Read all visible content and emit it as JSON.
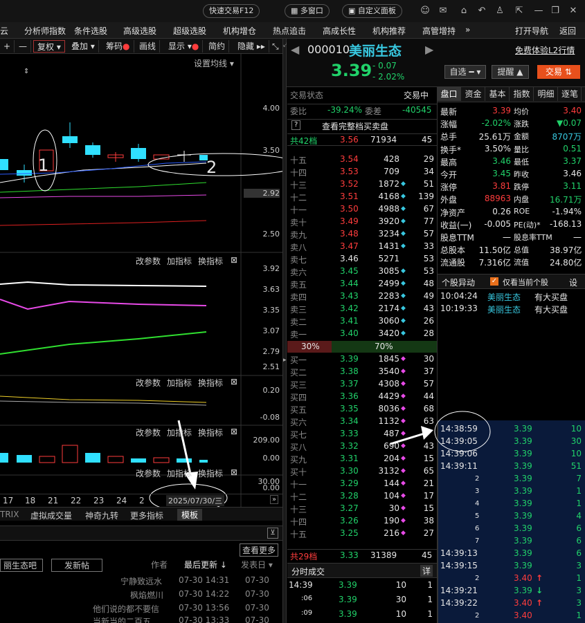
{
  "topbar": {
    "quick_trade": "快速交易F12",
    "multi_window": "多窗口",
    "custom_panel": "自定义面板"
  },
  "menu": [
    "云",
    "分析师指数",
    "条件选股",
    "高级选股",
    "超级选股",
    "机构增仓",
    "热点追击",
    "高成长性",
    "机构推荐",
    "高管增持"
  ],
  "menu_more": "»",
  "menu_right": [
    "打开导航",
    "返回"
  ],
  "chart_toolbar": {
    "items": [
      "复权",
      "叠加",
      "筹码",
      "画线",
      "显示",
      "简约",
      "隐藏"
    ],
    "set_ma": "设置均线"
  },
  "kline_axis": [
    "4.00",
    "3.50",
    "2.92",
    "2.50"
  ],
  "annotations": {
    "one": "1",
    "two": "2"
  },
  "sub_tools": {
    "params": "改参数",
    "add": "加指标",
    "switch": "换指标"
  },
  "sub1_axis": [
    "3.92",
    "3.63",
    "3.35",
    "3.07",
    "2.79",
    "2.51"
  ],
  "sub2_axis": [
    "0.20",
    "-0.08"
  ],
  "sub3_axis": [
    "209.00",
    "0.00"
  ],
  "sub4_axis": [
    "30.00",
    "0.00"
  ],
  "date_axis": [
    "17",
    "18",
    "21",
    "22",
    "23",
    "24",
    "2"
  ],
  "date_cursor": "2025/07/30/三",
  "bottom_tabs": [
    "TRIX",
    "虚拟成交量",
    "神奇九转",
    "更多指标",
    "模板"
  ],
  "forum": {
    "bar_label": "丽生态吧",
    "post": "发新帖",
    "more": "查看更多",
    "col_author": "作者",
    "col_update": "最后更新",
    "col_post": "发表日",
    "rows": [
      {
        "title": "",
        "author": "宁静致远水",
        "update": "07-30 14:31",
        "post": "07-30"
      },
      {
        "title": "",
        "author": "枫焰燃川",
        "update": "07-30 14:22",
        "post": "07-30"
      },
      {
        "title": "他们说的都不要信",
        "author": "",
        "update": "07-30 13:56",
        "post": "07-30"
      },
      {
        "title": "当新当的二百五",
        "author": "",
        "update": "07-30 13:33",
        "post": "07-30"
      }
    ]
  },
  "stock": {
    "code": "000010",
    "name": "美丽生态",
    "price": "3.39",
    "change": "- 0.07",
    "change_pct": "- 2.02%",
    "l2": "免费体验L2行情",
    "btn_watch": "自选",
    "btn_alert": "提醒",
    "btn_trade": "交易"
  },
  "trade_status": {
    "label": "交易状态",
    "value": "交易中"
  },
  "weibi": {
    "label": "委比",
    "value": "-39.24%",
    "label2": "委差",
    "value2": "-40545"
  },
  "full_book": "查看完整档买卖盘",
  "sell_total": {
    "label": "共42档",
    "price": "3.56",
    "vol": "71934",
    "cnt": "45"
  },
  "sells": [
    {
      "n": "十五",
      "p": "3.54",
      "v": "428",
      "c": "29",
      "d": false
    },
    {
      "n": "十四",
      "p": "3.53",
      "v": "709",
      "c": "34",
      "d": false
    },
    {
      "n": "十三",
      "p": "3.52",
      "v": "1872",
      "c": "51",
      "d": true
    },
    {
      "n": "十二",
      "p": "3.51",
      "v": "4168",
      "c": "139",
      "d": true
    },
    {
      "n": "十一",
      "p": "3.50",
      "v": "4988",
      "c": "67",
      "d": true
    },
    {
      "n": "卖十",
      "p": "3.49",
      "v": "3920",
      "c": "77",
      "d": true
    },
    {
      "n": "卖九",
      "p": "3.48",
      "v": "3234",
      "c": "57",
      "d": true
    },
    {
      "n": "卖八",
      "p": "3.47",
      "v": "1431",
      "c": "33",
      "d": true
    },
    {
      "n": "卖七",
      "p": "3.46",
      "v": "5271",
      "c": "53",
      "d": false
    },
    {
      "n": "卖六",
      "p": "3.45",
      "v": "3085",
      "c": "53",
      "d": true
    },
    {
      "n": "卖五",
      "p": "3.44",
      "v": "2499",
      "c": "48",
      "d": true
    },
    {
      "n": "卖四",
      "p": "3.43",
      "v": "2283",
      "c": "49",
      "d": true
    },
    {
      "n": "卖三",
      "p": "3.42",
      "v": "2174",
      "c": "43",
      "d": true
    },
    {
      "n": "卖二",
      "p": "3.41",
      "v": "3060",
      "c": "26",
      "d": true
    },
    {
      "n": "卖一",
      "p": "3.40",
      "v": "3420",
      "c": "28",
      "d": true
    }
  ],
  "ratio": {
    "left": "30%",
    "right": "70%"
  },
  "buys": [
    {
      "n": "买一",
      "p": "3.39",
      "v": "1845",
      "c": "30",
      "d": true
    },
    {
      "n": "买二",
      "p": "3.38",
      "v": "3540",
      "c": "37",
      "d": true
    },
    {
      "n": "买三",
      "p": "3.37",
      "v": "4308",
      "c": "57",
      "d": true
    },
    {
      "n": "买四",
      "p": "3.36",
      "v": "4429",
      "c": "44",
      "d": true
    },
    {
      "n": "买五",
      "p": "3.35",
      "v": "8036",
      "c": "68",
      "d": true
    },
    {
      "n": "买六",
      "p": "3.34",
      "v": "1132",
      "c": "63",
      "d": true
    },
    {
      "n": "买七",
      "p": "3.33",
      "v": "487",
      "c": "",
      "d": true
    },
    {
      "n": "买八",
      "p": "3.32",
      "v": "690",
      "c": "43",
      "d": true
    },
    {
      "n": "买九",
      "p": "3.31",
      "v": "204",
      "c": "15",
      "d": true
    },
    {
      "n": "买十",
      "p": "3.30",
      "v": "3132",
      "c": "65",
      "d": true
    },
    {
      "n": "十一",
      "p": "3.29",
      "v": "144",
      "c": "21",
      "d": true
    },
    {
      "n": "十二",
      "p": "3.28",
      "v": "104",
      "c": "17",
      "d": true
    },
    {
      "n": "十三",
      "p": "3.27",
      "v": "30",
      "c": "15",
      "d": true
    },
    {
      "n": "十四",
      "p": "3.26",
      "v": "190",
      "c": "38",
      "d": true
    },
    {
      "n": "十五",
      "p": "3.25",
      "v": "216",
      "c": "27",
      "d": true
    }
  ],
  "buy_total": {
    "label": "共29档",
    "price": "3.33",
    "vol": "31389",
    "cnt": "45"
  },
  "time_trades": {
    "title": "分时成交",
    "detail": "详",
    "rows": [
      {
        "t": "14:39",
        "p": "3.39",
        "v": "10",
        "c": "1"
      },
      {
        "t": ":06",
        "p": "3.39",
        "v": "30",
        "c": "1"
      },
      {
        "t": ":09",
        "p": "3.39",
        "v": "10",
        "c": "1"
      }
    ]
  },
  "info_tabs": [
    "盘口",
    "资金",
    "基本",
    "指数",
    "明细",
    "逐笔"
  ],
  "info": [
    [
      "最新",
      "3.39",
      "red",
      "均价",
      "3.40",
      "red"
    ],
    [
      "涨幅",
      "-2.02%",
      "green",
      "涨跌",
      "▼0.07",
      "green"
    ],
    [
      "总手",
      "25.61万",
      "white",
      "金额",
      "8707万",
      "cyan"
    ],
    [
      "换手*",
      "3.50%",
      "white",
      "量比",
      "0.51",
      "green"
    ],
    [
      "最高",
      "3.46",
      "green",
      "最低",
      "3.37",
      "green"
    ],
    [
      "今开",
      "3.45",
      "green",
      "昨收",
      "3.46",
      "white"
    ],
    [
      "涨停",
      "3.81",
      "red",
      "跌停",
      "3.11",
      "green"
    ],
    [
      "外盘",
      "88963",
      "red",
      "内盘",
      "16.71万",
      "green"
    ],
    [
      "净资产",
      "0.26",
      "white",
      "ROE",
      "-1.94%",
      "white"
    ],
    [
      "收益(一)",
      "-0.005",
      "white",
      "PE(动)*",
      "-168.13",
      "white"
    ],
    [
      "股息TTM",
      "一",
      "white",
      "股息率TTM",
      "一",
      "white"
    ],
    [
      "总股本",
      "11.50亿",
      "white",
      "总值",
      "38.97亿",
      "white"
    ],
    [
      "流通股",
      "7.316亿",
      "white",
      "流值",
      "24.80亿",
      "white"
    ]
  ],
  "alerts": {
    "title": "个股异动",
    "only_current": "仅看当前个股",
    "settings": "设",
    "rows": [
      {
        "t": "10:04:24",
        "name": "美丽生态",
        "msg": "有大买盘"
      },
      {
        "t": "10:19:33",
        "name": "美丽生态",
        "msg": "有大买盘"
      }
    ]
  },
  "ticks": [
    {
      "t": "14:38:59",
      "p": "3.39",
      "v": "10",
      "a": ""
    },
    {
      "t": "14:39:05",
      "p": "3.39",
      "v": "30",
      "a": ""
    },
    {
      "t": "14:39:06",
      "p": "3.39",
      "v": "10",
      "a": ""
    },
    {
      "t": "14:39:11",
      "p": "3.39",
      "v": "51",
      "a": ""
    },
    {
      "t": "2",
      "p": "3.39",
      "v": "7",
      "a": ""
    },
    {
      "t": "3",
      "p": "3.39",
      "v": "1",
      "a": ""
    },
    {
      "t": "4",
      "p": "3.39",
      "v": "1",
      "a": ""
    },
    {
      "t": "5",
      "p": "3.39",
      "v": "4",
      "a": ""
    },
    {
      "t": "6",
      "p": "3.39",
      "v": "6",
      "a": ""
    },
    {
      "t": "7",
      "p": "3.39",
      "v": "6",
      "a": ""
    },
    {
      "t": "14:39:13",
      "p": "3.39",
      "v": "6",
      "a": ""
    },
    {
      "t": "14:39:15",
      "p": "3.39",
      "v": "3",
      "a": ""
    },
    {
      "t": "2",
      "p": "3.40",
      "v": "1",
      "a": "up"
    },
    {
      "t": "14:39:21",
      "p": "3.39",
      "v": "3",
      "a": "down"
    },
    {
      "t": "14:39:22",
      "p": "3.40",
      "v": "3",
      "a": "up"
    },
    {
      "t": "2",
      "p": "3.40",
      "v": "1",
      "a": ""
    }
  ]
}
